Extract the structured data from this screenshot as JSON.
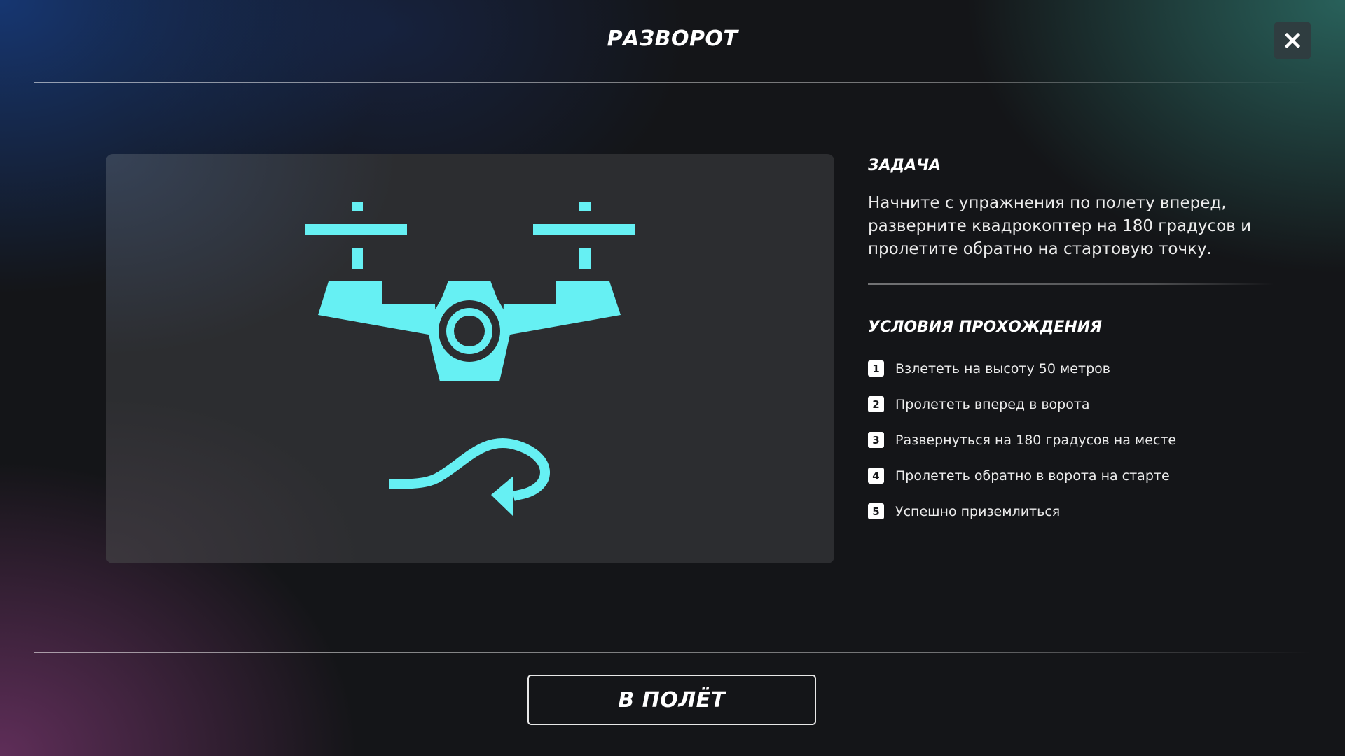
{
  "header": {
    "title": "РАЗВОРОТ",
    "close_icon": "close-icon"
  },
  "illustration": {
    "icons": [
      "drone-icon",
      "u-turn-arrow-icon"
    ],
    "accent_color": "#66f0f3"
  },
  "task": {
    "heading": "ЗАДАЧА",
    "lines": [
      "Начните с упражнения по полету вперед,",
      "разверните квадрокоптер на 180 градусов и",
      "пролетите обратно на стартовую точку."
    ]
  },
  "conditions": {
    "heading": "УСЛОВИЯ ПРОХОЖДЕНИЯ",
    "items": [
      {
        "num": "1",
        "text": "Взлететь на высоту 50 метров"
      },
      {
        "num": "2",
        "text": "Пролететь вперед в ворота"
      },
      {
        "num": "3",
        "text": "Развернуться на 180 градусов на месте"
      },
      {
        "num": "4",
        "text": "Пролететь обратно в ворота на старте"
      },
      {
        "num": "5",
        "text": "Успешно приземлиться"
      }
    ]
  },
  "footer": {
    "fly_button_label": "В ПОЛЁТ"
  },
  "colors": {
    "accent": "#66f0f3",
    "panel": "#2c2d30",
    "close_button_bg": "#2f3d40",
    "background": "#141518"
  }
}
